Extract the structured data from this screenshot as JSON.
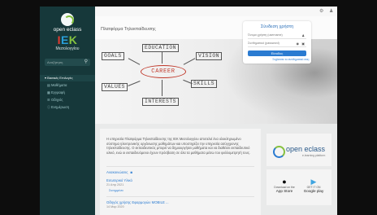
{
  "sidebar": {
    "logo_name": "open eclass",
    "logo_iek": [
      "I",
      "E",
      "K"
    ],
    "logo_city": "Μεσολογγίου",
    "search_placeholder": "Αναζήτηση",
    "section_label": "Βασικές Επιλογές",
    "items": [
      {
        "icon": "book-icon",
        "label": "Μαθήματα"
      },
      {
        "icon": "grid-icon",
        "label": "Εγγραφή"
      },
      {
        "icon": "list-icon",
        "label": "Οδηγός"
      },
      {
        "icon": "info-icon",
        "label": "Ενημέρωση"
      }
    ]
  },
  "topbar": {
    "icons": [
      "gear-icon",
      "user-icon"
    ]
  },
  "page": {
    "title": "Πλατφόρμα Τηλεκπαίδευσης"
  },
  "hero": {
    "words": [
      "GOALS",
      "EDUCATION",
      "VISION",
      "CAREER",
      "VALUES",
      "SKILLS",
      "INTERESTS"
    ]
  },
  "login": {
    "title": "Σύνδεση χρήστη",
    "username_label": "Όνομα χρήστη (username)",
    "password_label": "Συνθηματικό (password)",
    "button_label": "Είσοδος",
    "forgot_link": "Ξεχάσατε το συνθηματικό σας;"
  },
  "intro_text": "Η υπηρεσία Πλατφόρμα Τηλεκπαίδευσης της ΙΕΚ Μεσολογγίου αποτελεί ένα ολοκληρωμένο σύστημα ηλεκτρονικής οργάνωσης μαθημάτων και υποστηρίζει την υπηρεσία ασύγχρονης τηλεκπαίδευσης. Ο εκπαιδευτικός μπορεί να δημιουργήσει μαθήματα και να διαθέσει εκπαιδευτικό υλικό, ενώ οι εκπαιδευόμενοι έχουν πρόσβαση σε όλα τα μαθήματα μέσω του φυλλομετρητή τους.",
  "announcements": {
    "heading": "Ανακοινώσεις",
    "items": [
      {
        "title": "Εσωτερικό Υλικό",
        "date": "21 Απρ 2021",
        "attachment": "Συνημμένα"
      },
      {
        "title": "Οδηγός χρήσης Εφαρμογών MOBILE ...",
        "date": "14 Μαρ 2020",
        "attachment": ""
      }
    ]
  },
  "side": {
    "brand": "open eclass",
    "brand_sub": "e-learning platform",
    "appstore": {
      "small": "Download on the",
      "name": "App Store"
    },
    "googleplay": {
      "small": "GET IT ON",
      "name": "Google play"
    }
  }
}
